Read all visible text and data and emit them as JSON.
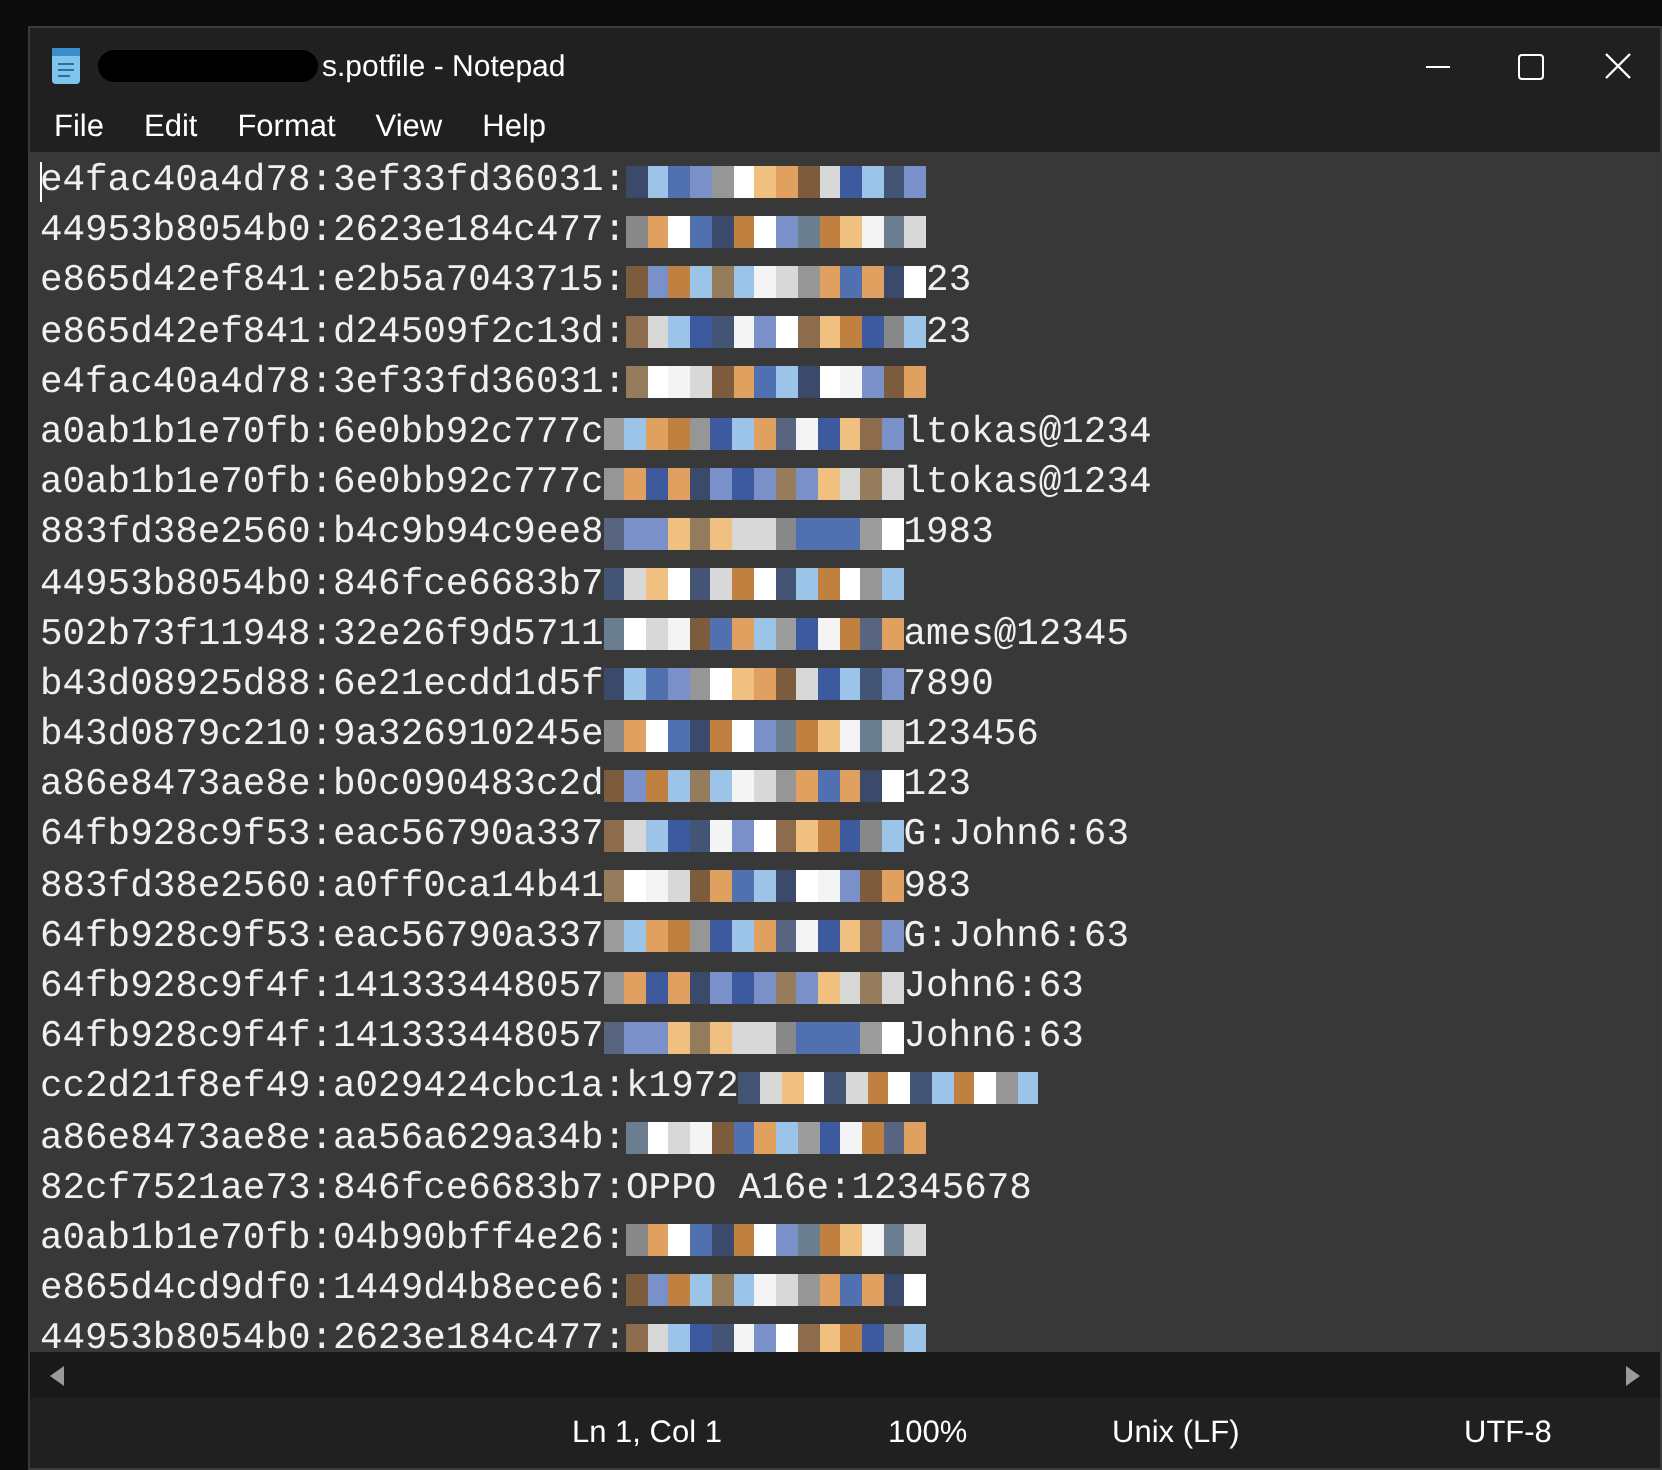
{
  "window": {
    "title": "s.potfile - Notepad",
    "title_redacted": true
  },
  "menu": [
    "File",
    "Edit",
    "Format",
    "View",
    "Help"
  ],
  "lines": [
    {
      "kind": "masked",
      "text": "e4fac40a4d78:3ef33fd36031:"
    },
    {
      "kind": "masked",
      "text": "44953b8054b0:2623e184c477:"
    },
    {
      "kind": "masked",
      "text": "e865d42ef841:e2b5a7043715:",
      "tail": "23"
    },
    {
      "kind": "masked",
      "text": "e865d42ef841:d24509f2c13d:",
      "tail": "23"
    },
    {
      "kind": "masked",
      "text": "e4fac40a4d78:3ef33fd36031:"
    },
    {
      "kind": "masked",
      "text": "a0ab1b1e70fb:6e0bb92c777c",
      "tail": "ltokas@1234"
    },
    {
      "kind": "masked",
      "text": "a0ab1b1e70fb:6e0bb92c777c",
      "tail": "ltokas@1234"
    },
    {
      "kind": "masked",
      "text": "883fd38e2560:b4c9b94c9ee8",
      "tail": "1983"
    },
    {
      "kind": "masked",
      "text": "44953b8054b0:846fce6683b7"
    },
    {
      "kind": "masked",
      "text": "502b73f11948:32e26f9d5711",
      "tail": "ames@12345"
    },
    {
      "kind": "masked",
      "text": "b43d08925d88:6e21ecdd1d5f",
      "tail": "7890"
    },
    {
      "kind": "masked",
      "text": "b43d0879c210:9a326910245e",
      "tail": "123456"
    },
    {
      "kind": "masked",
      "text": "a86e8473ae8e:b0c090483c2d",
      "tail": "123"
    },
    {
      "kind": "masked",
      "text": "64fb928c9f53:eac56790a337",
      "tail": "G:John6:63"
    },
    {
      "kind": "masked",
      "text": "883fd38e2560:a0ff0ca14b41",
      "tail": "983"
    },
    {
      "kind": "masked",
      "text": "64fb928c9f53:eac56790a337",
      "tail": "G:John6:63"
    },
    {
      "kind": "masked",
      "text": "64fb928c9f4f:141333448057",
      "tail": "John6:63"
    },
    {
      "kind": "masked",
      "text": "64fb928c9f4f:141333448057",
      "tail": "John6:63"
    },
    {
      "kind": "masked",
      "text": "cc2d21f8ef49:a029424cbc1a:k1972"
    },
    {
      "kind": "masked",
      "text": "a86e8473ae8e:aa56a629a34b:"
    },
    {
      "kind": "plain",
      "text": "82cf7521ae73:846fce6683b7:OPPO A16e:12345678"
    },
    {
      "kind": "masked",
      "text": "a0ab1b1e70fb:04b90bff4e26:"
    },
    {
      "kind": "masked",
      "text": "e865d4cd9df0:1449d4b8ece6:"
    },
    {
      "kind": "masked",
      "text": "44953b8054b0:2623e184c477:"
    }
  ],
  "status_bar": {
    "position": "Ln 1, Col 1",
    "zoom": "100%",
    "line_ending": "Unix (LF)",
    "encoding": "UTF-8"
  }
}
